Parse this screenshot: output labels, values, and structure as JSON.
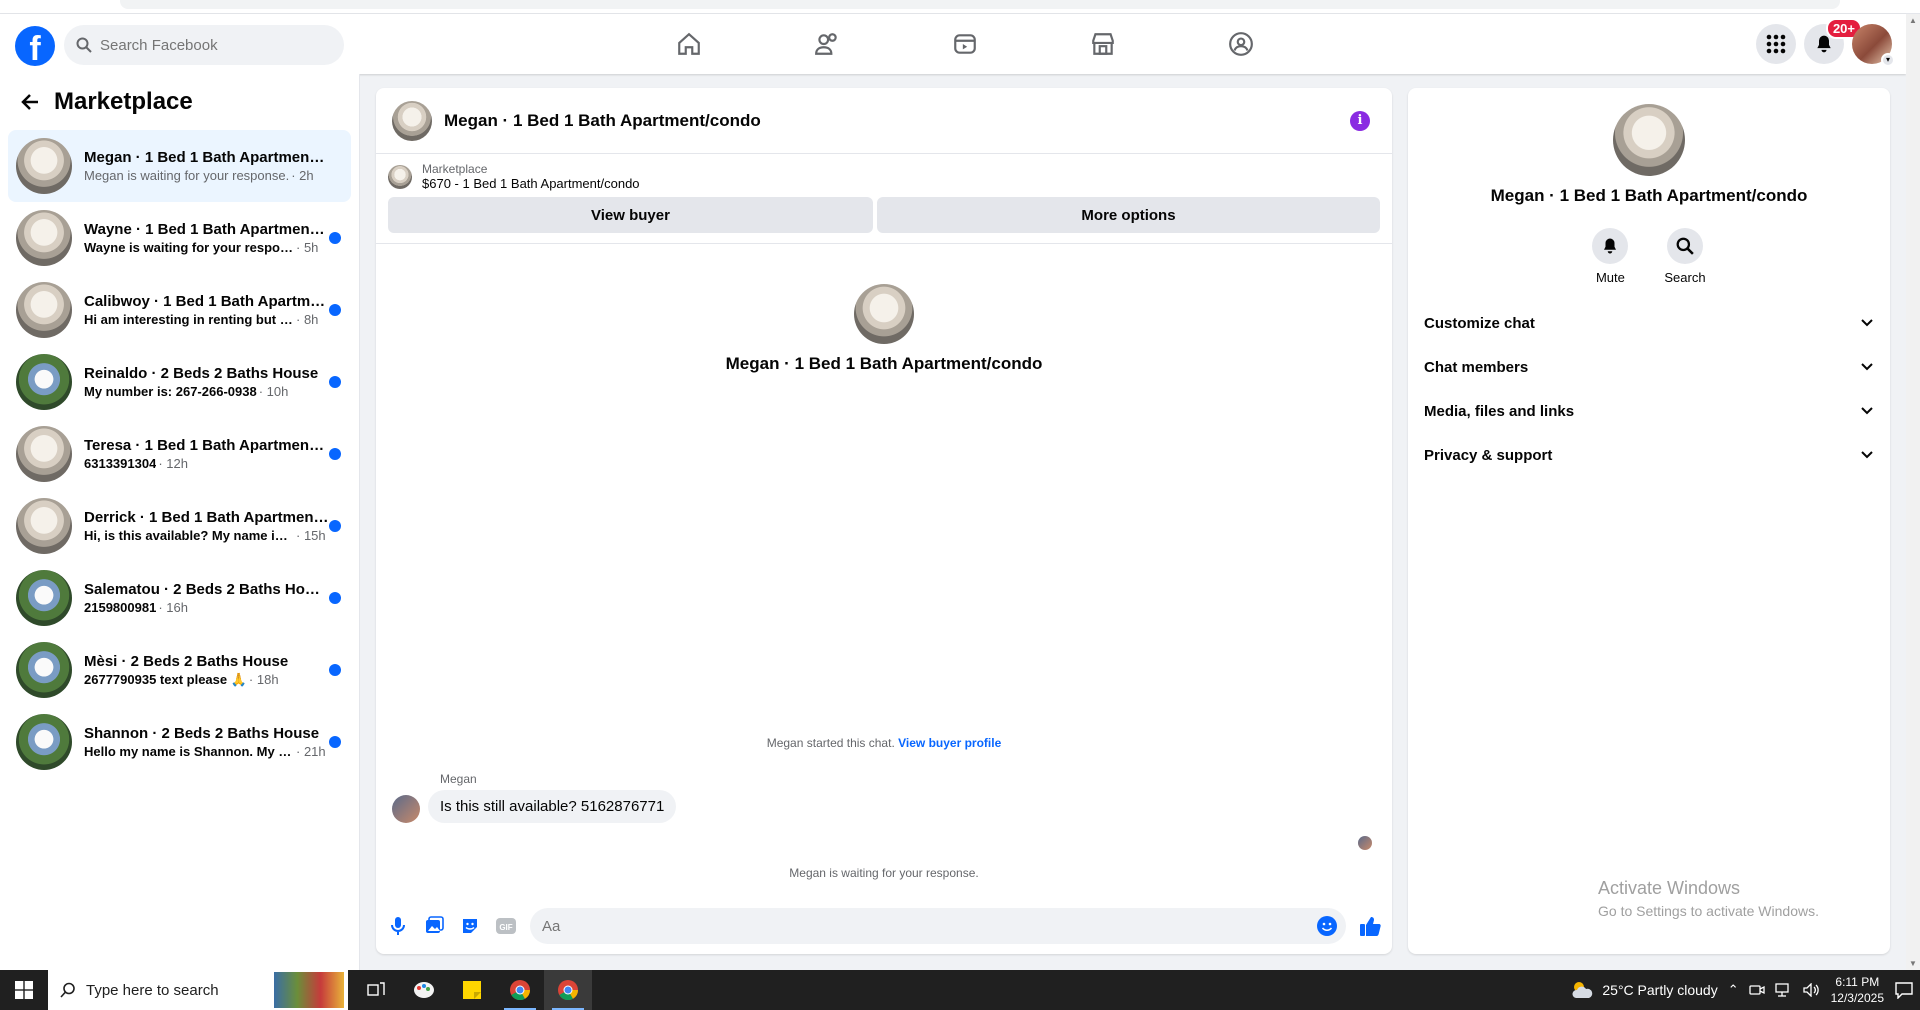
{
  "nav": {
    "search_placeholder": "Search Facebook",
    "notification_badge": "20+",
    "icons": [
      "home-icon",
      "friends-icon",
      "video-icon",
      "marketplace-icon",
      "groups-icon"
    ]
  },
  "sidebar": {
    "title": "Marketplace",
    "conversations": [
      {
        "name": "Megan · 1 Bed 1 Bath Apartment/c...",
        "preview": "Megan is waiting for your response.",
        "time": "· 2h",
        "thumb": "apt",
        "unread": false,
        "active": true
      },
      {
        "name": "Wayne · 1 Bed 1 Bath Apartment/...",
        "preview": "Wayne is waiting for your response.",
        "time": "· 5h",
        "thumb": "apt",
        "unread": true
      },
      {
        "name": "Calibwoy · 1 Bed 1 Bath Apartme...",
        "preview": "Hi am interesting in renting but m...",
        "time": "· 8h",
        "thumb": "apt",
        "unread": true
      },
      {
        "name": "Reinaldo · 2 Beds 2 Baths House",
        "preview": "My number is: 267-266-0938",
        "time": "· 10h",
        "thumb": "house",
        "unread": true
      },
      {
        "name": "Teresa · 1 Bed 1 Bath Apartment/...",
        "preview": "6313391304",
        "time": "· 12h",
        "thumb": "apt",
        "unread": true
      },
      {
        "name": "Derrick · 1 Bed 1 Bath Apartment...",
        "preview": "Hi, is this available? My name is D...",
        "time": "· 15h",
        "thumb": "apt",
        "unread": true
      },
      {
        "name": "Salematou · 2 Beds 2 Baths House",
        "preview": "2159800981",
        "time": "· 16h",
        "thumb": "house",
        "unread": true
      },
      {
        "name": "Mèsi · 2 Beds 2 Baths House",
        "preview": "2677790935 text please 🙏",
        "time": "· 18h",
        "thumb": "house",
        "unread": true
      },
      {
        "name": "Shannon · 2 Beds 2 Baths House",
        "preview": "Hello my name is Shannon. My in...",
        "time": "· 21h",
        "thumb": "house",
        "unread": true
      }
    ]
  },
  "chat": {
    "title": "Megan · 1 Bed 1 Bath Apartment/condo",
    "listing_source": "Marketplace",
    "listing_detail": "$670 - 1 Bed 1 Bath Apartment/condo",
    "view_buyer": "View buyer",
    "more_options": "More options",
    "center_name": "Megan · 1 Bed 1 Bath Apartment/condo",
    "started_text": "Megan started this chat.",
    "view_buyer_profile": "View buyer profile",
    "sender": "Megan",
    "message": "Is this still available?  5162876771",
    "waiting": "Megan is waiting for your response.",
    "composer_placeholder": "Aa"
  },
  "details": {
    "name": "Megan · 1 Bed 1 Bath Apartment/condo",
    "mute": "Mute",
    "search": "Search",
    "sections": [
      "Customize chat",
      "Chat members",
      "Media, files and links",
      "Privacy & support"
    ]
  },
  "watermark": {
    "line1": "Activate Windows",
    "line2": "Go to Settings to activate Windows."
  },
  "taskbar": {
    "search_placeholder": "Type here to search",
    "weather": "25°C  Partly cloudy",
    "time": "6:11 PM",
    "date": "12/3/2025"
  },
  "colors": {
    "accent": "#0866ff",
    "unread_dot": "#0866ff",
    "badge": "#e41e3f",
    "info": "#8a2be2"
  }
}
